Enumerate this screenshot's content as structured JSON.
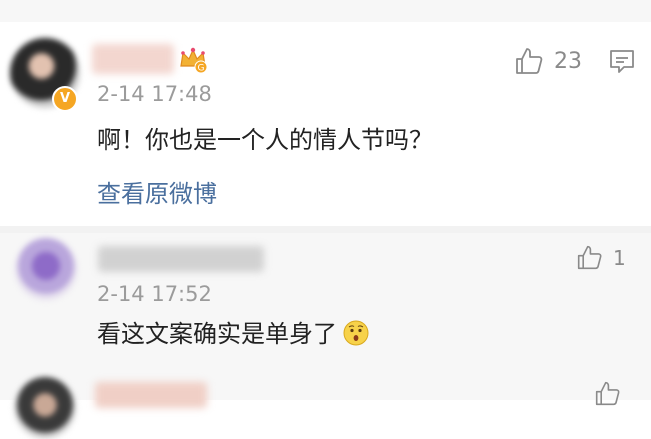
{
  "comments": [
    {
      "author": "",
      "verified_badge": "V",
      "vip_badge_text": "G",
      "time": "2-14 17:48",
      "text": "啊！你也是一个人的情人节吗？",
      "likes": "23",
      "view_original_label": "查看原微博",
      "icons": [
        "thumbs-up-icon",
        "reply-icon",
        "crown-icon"
      ]
    },
    {
      "author": "",
      "time": "2-14 17:52",
      "text": "看这文案确实是单身了",
      "emoji": "surprised-face-emoji",
      "likes": "1",
      "icons": [
        "thumbs-up-icon"
      ]
    },
    {
      "author": "",
      "icons": [
        "thumbs-up-icon"
      ]
    }
  ],
  "colors": {
    "link": "#4a6f9e",
    "meta": "#9b9b9b",
    "reply_background": "#f7f7f7",
    "verified": "#f5a623"
  }
}
